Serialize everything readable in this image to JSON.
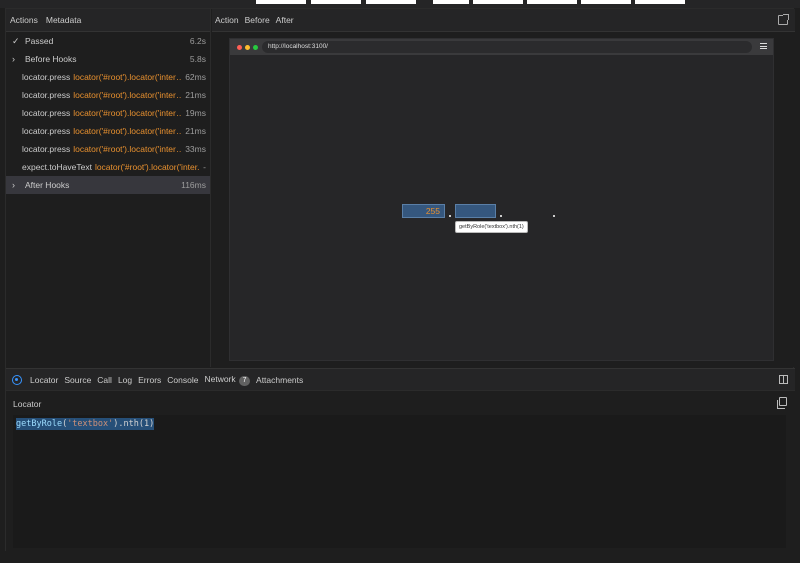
{
  "left_panel": {
    "tabs": [
      "Actions",
      "Metadata"
    ],
    "items": [
      {
        "kind": "status",
        "icon": "check-icon",
        "name": "Passed",
        "time": "6.2s"
      },
      {
        "kind": "hook",
        "icon": "chevron-right-icon",
        "name": "Before Hooks",
        "time": "5.8s"
      },
      {
        "kind": "action",
        "name": "locator.press",
        "selector": "locator('#root').locator('intern...",
        "time": "62ms"
      },
      {
        "kind": "action",
        "name": "locator.press",
        "selector": "locator('#root').locator('intern...",
        "time": "21ms"
      },
      {
        "kind": "action",
        "name": "locator.press",
        "selector": "locator('#root').locator('intern...",
        "time": "19ms"
      },
      {
        "kind": "action",
        "name": "locator.press",
        "selector": "locator('#root').locator('intern...",
        "time": "21ms"
      },
      {
        "kind": "action",
        "name": "locator.press",
        "selector": "locator('#root').locator('intern...",
        "time": "33ms"
      },
      {
        "kind": "action",
        "name": "expect.toHaveText",
        "selector": "locator('#root').locator('inter...",
        "time": "-"
      },
      {
        "kind": "hook",
        "icon": "chevron-right-icon",
        "name": "After Hooks",
        "time": "116ms"
      }
    ]
  },
  "snapshot": {
    "tabs": [
      "Action",
      "Before",
      "After"
    ],
    "url": "http://localhost:3100/",
    "input_value": "255",
    "tooltip": "getByRole('textbox').nth(1)"
  },
  "bottom_panel": {
    "tabs": [
      "Locator",
      "Source",
      "Call",
      "Log",
      "Errors",
      "Console",
      "Network",
      "Attachments"
    ],
    "network_count": "7",
    "locator_label": "Locator",
    "code": {
      "fn": "getByRole",
      "open": "(",
      "arg": "'textbox'",
      "rest": ").nth(1)"
    }
  },
  "colors": {
    "accent": "#3794ff",
    "selector": "#e9912f",
    "selection": "#37373d",
    "highlight": "#35577e"
  }
}
